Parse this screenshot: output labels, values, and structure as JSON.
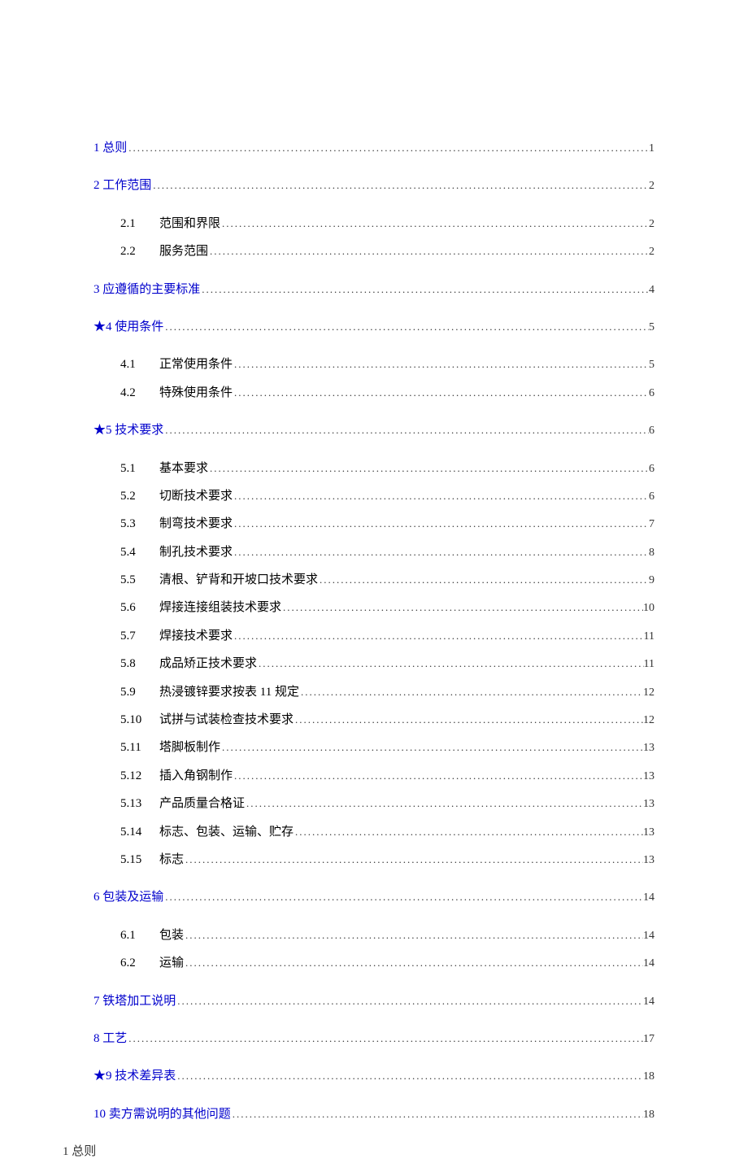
{
  "toc": [
    {
      "level": 1,
      "num": "1",
      "title": "总则",
      "page": "1",
      "blue": true
    },
    {
      "level": 1,
      "num": "2",
      "title": "工作范围",
      "page": "2",
      "blue": true
    },
    {
      "level": 2,
      "num": "2.1",
      "title": "范围和界限",
      "page": "2",
      "first": true
    },
    {
      "level": 2,
      "num": "2.2",
      "title": "服务范围",
      "page": "2",
      "last": true
    },
    {
      "level": 1,
      "num": "3",
      "title": "应遵循的主要标准",
      "page": "4",
      "blue": true
    },
    {
      "level": 1,
      "num": "★4",
      "title": "使用条件",
      "page": "5",
      "blue": true
    },
    {
      "level": 2,
      "num": "4.1",
      "title": "正常使用条件",
      "page": "5",
      "first": true
    },
    {
      "level": 2,
      "num": "4.2",
      "title": "特殊使用条件",
      "page": "6",
      "last": true
    },
    {
      "level": 1,
      "num": "★5",
      "title": "技术要求",
      "page": "6",
      "blue": true
    },
    {
      "level": 2,
      "num": "5.1",
      "title": "基本要求",
      "page": "6",
      "first": true
    },
    {
      "level": 2,
      "num": "5.2",
      "title": "切断技术要求",
      "page": "6"
    },
    {
      "level": 2,
      "num": "5.3",
      "title": "制弯技术要求",
      "page": "7"
    },
    {
      "level": 2,
      "num": "5.4",
      "title": "制孔技术要求",
      "page": "8"
    },
    {
      "level": 2,
      "num": "5.5",
      "title": "清根、铲背和开坡口技术要求",
      "page": "9"
    },
    {
      "level": 2,
      "num": "5.6",
      "title": "焊接连接组装技术要求",
      "page": "10"
    },
    {
      "level": 2,
      "num": "5.7",
      "title": "焊接技术要求",
      "page": "11"
    },
    {
      "level": 2,
      "num": "5.8",
      "title": "成品矫正技术要求",
      "page": "11"
    },
    {
      "level": 2,
      "num": "5.9",
      "title": "热浸镀锌要求按表 11 规定",
      "page": "12"
    },
    {
      "level": 2,
      "num": "5.10",
      "title": "试拼与试装检查技术要求",
      "page": "12"
    },
    {
      "level": 2,
      "num": "5.11",
      "title": "塔脚板制作",
      "page": "13"
    },
    {
      "level": 2,
      "num": "5.12",
      "title": "插入角钢制作",
      "page": "13"
    },
    {
      "level": 2,
      "num": "5.13",
      "title": "产品质量合格证",
      "page": "13"
    },
    {
      "level": 2,
      "num": "5.14",
      "title": "标志、包装、运输、贮存",
      "page": "13"
    },
    {
      "level": 2,
      "num": "5.15",
      "title": "标志",
      "page": "13",
      "last": true
    },
    {
      "level": 1,
      "num": "6",
      "title": "包装及运输",
      "page": "14",
      "blue": true
    },
    {
      "level": 2,
      "num": "6.1",
      "title": "包装",
      "page": "14",
      "first": true
    },
    {
      "level": 2,
      "num": "6.2",
      "title": "运输",
      "page": "14",
      "last": true
    },
    {
      "level": 1,
      "num": "7",
      "title": "铁塔加工说明",
      "page": "14",
      "blue": true
    },
    {
      "level": 1,
      "num": "8",
      "title": "工艺",
      "page": "17",
      "blue": true
    },
    {
      "level": 1,
      "num": "★9",
      "title": "技术差异表",
      "page": "18",
      "blue": true
    },
    {
      "level": 1,
      "num": "10",
      "title": "卖方需说明的其他问题",
      "page": "18",
      "blue": true
    }
  ],
  "heading": "1 总则"
}
